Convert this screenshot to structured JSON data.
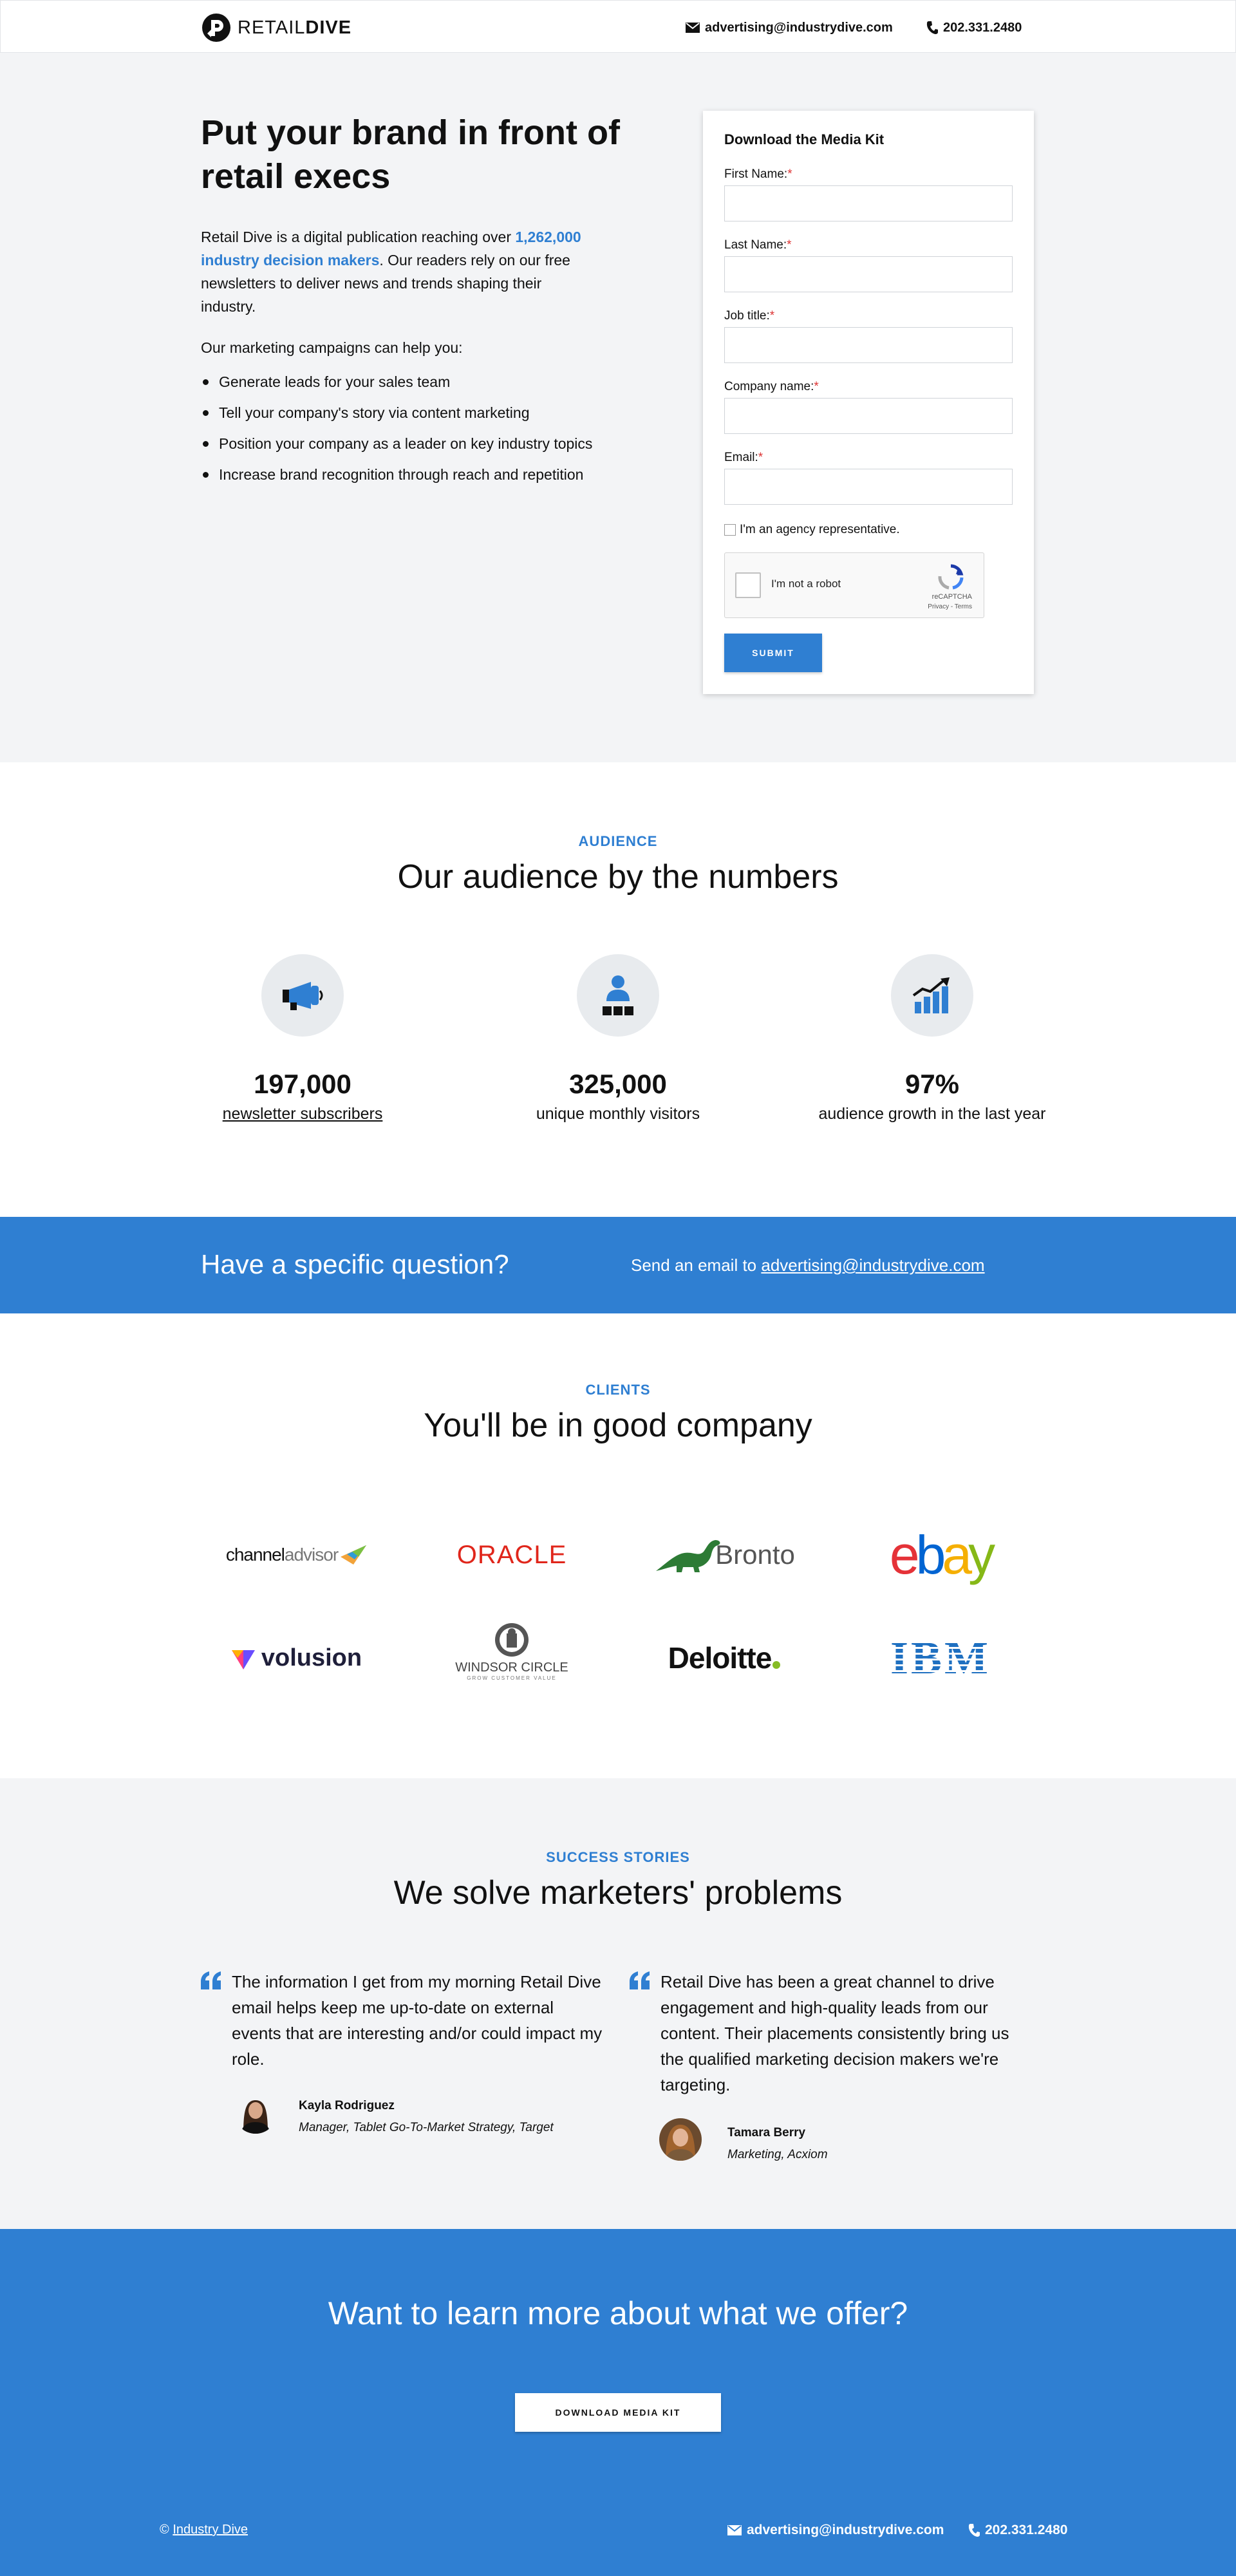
{
  "header": {
    "logo_light": "RETAIL",
    "logo_bold": "DIVE",
    "email": "advertising@industrydive.com",
    "phone": "202.331.2480"
  },
  "hero": {
    "title": "Put your brand in front of retail execs",
    "intro_before": "Retail Dive is a digital publication reaching over",
    "intro_highlight": "1,262,000 industry decision makers",
    "intro_after": ". Our readers rely on our free newsletters to deliver news and trends shaping their industry.",
    "help_text": "Our marketing campaigns can help you:",
    "bullets": [
      "Generate leads for your sales team",
      "Tell your company's story via content marketing",
      "Position your company as a leader on key industry topics",
      "Increase brand recognition through reach and repetition"
    ]
  },
  "form": {
    "title": "Download the Media Kit",
    "fields": [
      {
        "label": "First Name:",
        "value": ""
      },
      {
        "label": "Last Name:",
        "value": ""
      },
      {
        "label": "Job title:",
        "value": ""
      },
      {
        "label": "Company name:",
        "value": ""
      },
      {
        "label": "Email:",
        "value": ""
      }
    ],
    "required_mark": "*",
    "agency_label": "I'm an agency representative.",
    "captcha_label": "I'm not a robot",
    "captcha_brand": "reCAPTCHA",
    "captcha_terms": "Privacy - Terms",
    "submit_label": "SUBMIT"
  },
  "audience": {
    "eyebrow": "AUDIENCE",
    "title": "Our audience by the numbers",
    "stats": [
      {
        "icon": "megaphone-icon",
        "value": "197,000",
        "label": "newsletter subscribers"
      },
      {
        "icon": "audience-person-icon",
        "value": "325,000",
        "label": "unique monthly visitors"
      },
      {
        "icon": "growth-chart-icon",
        "value": "97%",
        "label": "audience growth in the last year"
      }
    ]
  },
  "question": {
    "title": "Have a specific question?",
    "text": "Send an email to",
    "email": "advertising@industrydive.com"
  },
  "clients": {
    "eyebrow": "CLIENTS",
    "title": "You'll be in good company",
    "logos": {
      "channeladvisor_a": "channel",
      "channeladvisor_b": "advisor",
      "oracle": "ORACLE",
      "bronto": "Bronto",
      "ebay": [
        "e",
        "b",
        "a",
        "y"
      ],
      "volusion": "volusion",
      "windsor": "WINDSOR CIRCLE",
      "windsor_tag": "GROW CUSTOMER VALUE",
      "deloitte": "Deloitte",
      "ibm": "IBM"
    }
  },
  "stories": {
    "eyebrow": "SUCCESS STORIES",
    "title": "We solve marketers' problems",
    "quotes": [
      {
        "text": "The information I get from my morning Retail Dive email helps keep me up-to-date on external events that are interesting and/or could impact my role.",
        "name": "Kayla Rodriguez",
        "role": "Manager, Tablet Go-To-Market Strategy, Target"
      },
      {
        "text": "Retail Dive has been a great channel to drive engagement and high-quality leads from our content. Their placements consistently bring us the qualified marketing decision makers we're targeting.",
        "name": "Tamara Berry",
        "role": "Marketing, Acxiom"
      }
    ]
  },
  "cta": {
    "title": "Want to learn more about what we offer?",
    "button": "DOWNLOAD MEDIA KIT"
  },
  "footer": {
    "copyright_symbol": "©",
    "company": "Industry Dive",
    "email": "advertising@industrydive.com",
    "phone": "202.331.2480"
  },
  "colors": {
    "accent": "#2f7fd2",
    "hero_bg": "#f3f4f6",
    "text": "#111111"
  }
}
